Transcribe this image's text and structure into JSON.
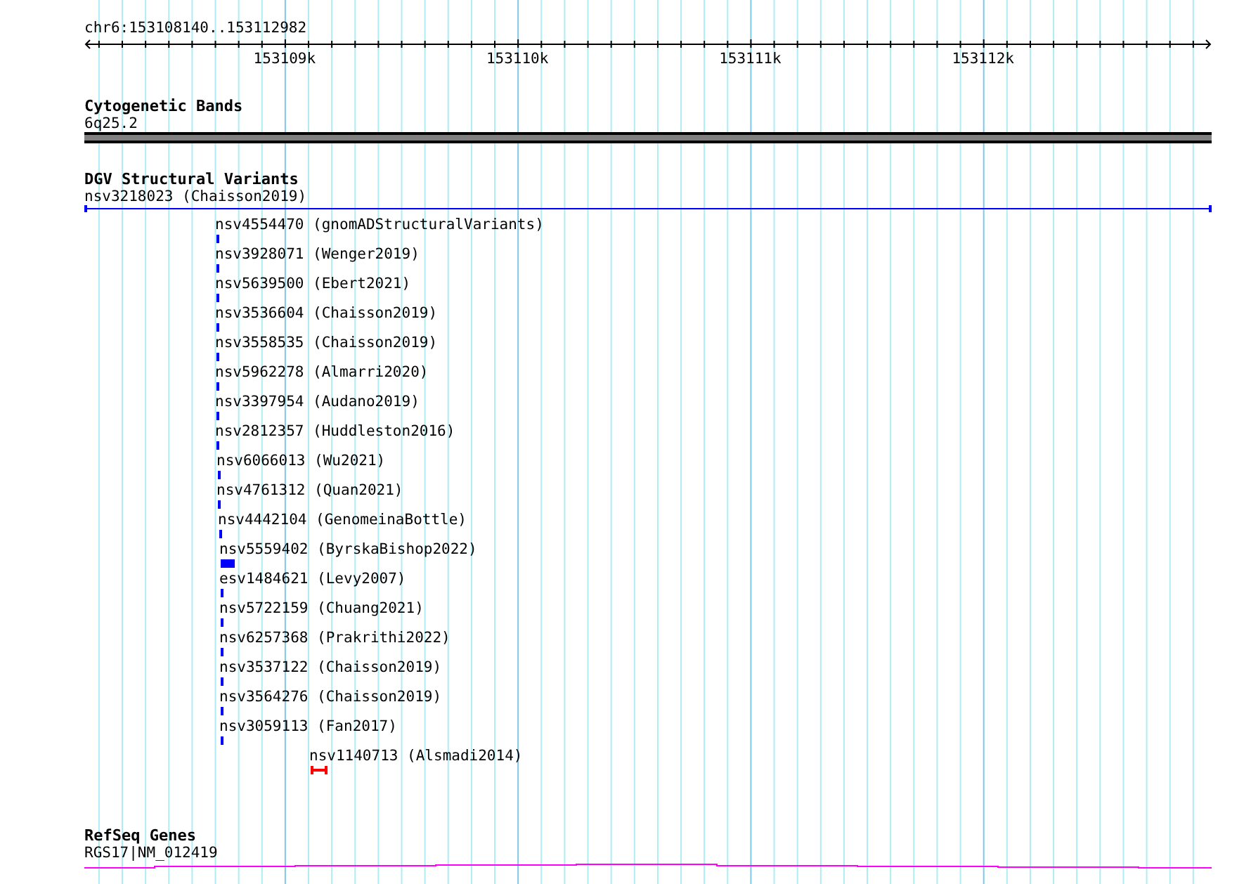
{
  "ruler": {
    "location": "chr6:153108140..153112982",
    "tick_labels": [
      "153109k",
      "153110k",
      "153111k",
      "153112k"
    ]
  },
  "tracks": [
    {
      "kind": "cytoband",
      "title": "Cytogenetic Bands",
      "label": "6q25.2"
    },
    {
      "kind": "variants",
      "title": "DGV Structural Variants",
      "summary": {
        "label": "nsv3218023 (Chaisson2019)",
        "color": "#0000ff"
      },
      "features": [
        {
          "label": "nsv4554470 (gnomADStructuralVariants)",
          "kind": "tick",
          "color": "#0000ff"
        },
        {
          "label": "nsv3928071 (Wenger2019)",
          "kind": "tick",
          "color": "#0000ff"
        },
        {
          "label": "nsv5639500 (Ebert2021)",
          "kind": "tick",
          "color": "#0000ff"
        },
        {
          "label": "nsv3536604 (Chaisson2019)",
          "kind": "tick",
          "color": "#0000ff"
        },
        {
          "label": "nsv3558535 (Chaisson2019)",
          "kind": "tick",
          "color": "#0000ff"
        },
        {
          "label": "nsv5962278 (Almarri2020)",
          "kind": "tick",
          "color": "#0000ff"
        },
        {
          "label": "nsv3397954 (Audano2019)",
          "kind": "tick",
          "color": "#0000ff"
        },
        {
          "label": "nsv2812357 (Huddleston2016)",
          "kind": "tick",
          "color": "#0000ff"
        },
        {
          "label": "nsv6066013 (Wu2021)",
          "kind": "tick",
          "color": "#0000ff"
        },
        {
          "label": "nsv4761312 (Quan2021)",
          "kind": "tick",
          "color": "#0000ff"
        },
        {
          "label": "nsv4442104 (GenomeinaBottle)",
          "kind": "tick",
          "color": "#0000ff"
        },
        {
          "label": "nsv5559402 (ByrskaBishop2022)",
          "kind": "block",
          "color": "#0000ff"
        },
        {
          "label": "esv1484621 (Levy2007)",
          "kind": "tick",
          "color": "#0000ff"
        },
        {
          "label": "nsv5722159 (Chuang2021)",
          "kind": "tick",
          "color": "#0000ff"
        },
        {
          "label": "nsv6257368 (Prakrithi2022)",
          "kind": "tick",
          "color": "#0000ff"
        },
        {
          "label": "nsv3537122 (Chaisson2019)",
          "kind": "tick",
          "color": "#0000ff"
        },
        {
          "label": "nsv3564276 (Chaisson2019)",
          "kind": "tick",
          "color": "#0000ff"
        },
        {
          "label": "nsv3059113 (Fan2017)",
          "kind": "tick",
          "color": "#0000ff"
        },
        {
          "label": "nsv1140713 (Alsmadi2014)",
          "kind": "span",
          "color": "#ff0000"
        }
      ]
    },
    {
      "kind": "genes",
      "title": "RefSeq Genes",
      "label": "RGS17|NM_012419"
    }
  ]
}
